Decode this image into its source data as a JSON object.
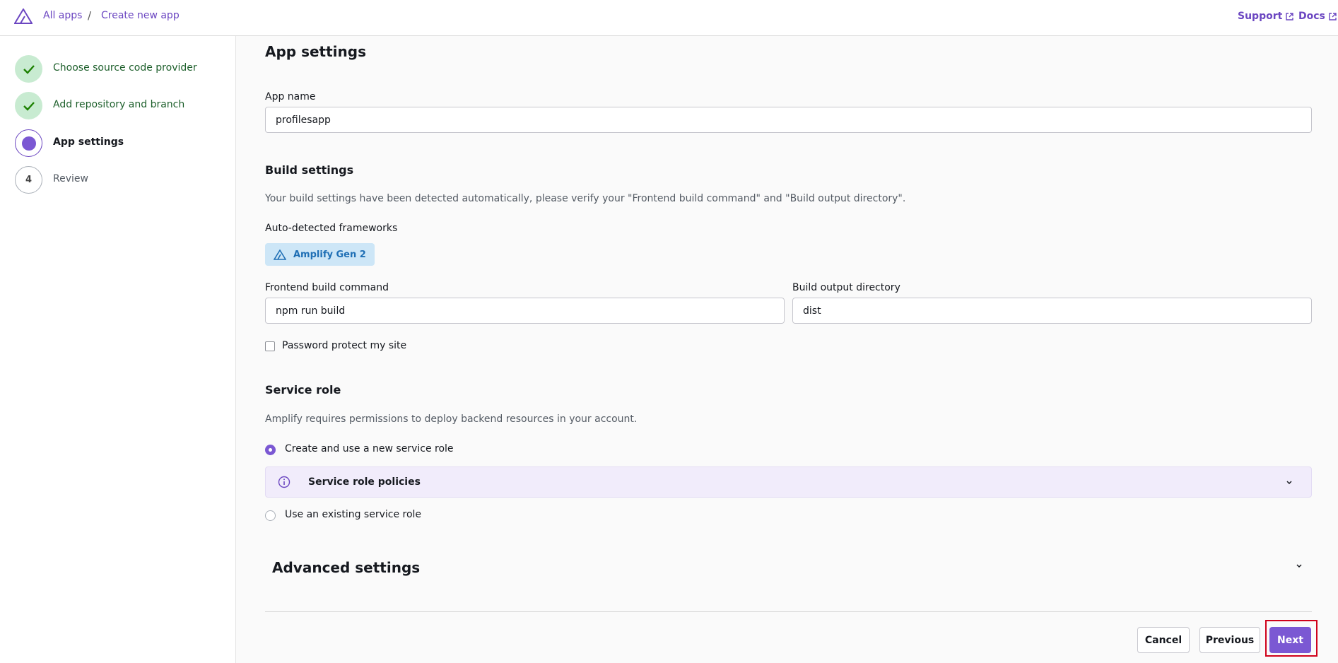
{
  "header": {
    "breadcrumb": [
      {
        "label": "All apps"
      },
      {
        "label": "Create new app"
      }
    ],
    "separator": "/",
    "links": [
      {
        "label": "Support"
      },
      {
        "label": "Docs"
      }
    ]
  },
  "steps": [
    {
      "label": "Choose source code provider",
      "state": "done"
    },
    {
      "label": "Add repository and branch",
      "state": "done"
    },
    {
      "label": "App settings",
      "state": "current"
    },
    {
      "label": "Review",
      "state": "todo",
      "number": "4"
    }
  ],
  "main": {
    "title": "App settings",
    "app_name": {
      "label": "App name",
      "value": "profilesapp"
    },
    "build": {
      "title": "Build settings",
      "description": "Your build settings have been detected automatically, please verify your \"Frontend build command\" and \"Build output directory\".",
      "frameworks_label": "Auto-detected frameworks",
      "framework": "Amplify Gen 2",
      "frontend_label": "Frontend build command",
      "frontend_value": "npm run build",
      "output_label": "Build output directory",
      "output_value": "dist",
      "password_label": "Password protect my site",
      "password_checked": false
    },
    "service_role": {
      "title": "Service role",
      "description": "Amplify requires permissions to deploy backend resources in your account.",
      "option_new": "Create and use a new service role",
      "policies_title": "Service role policies",
      "option_existing": "Use an existing service role",
      "selected": "new"
    },
    "advanced": {
      "title": "Advanced settings"
    }
  },
  "footer": {
    "cancel": "Cancel",
    "previous": "Previous",
    "next": "Next"
  },
  "colors": {
    "accent": "#7b58d3",
    "link": "#6b46c1",
    "done": "#c8ebd1",
    "badge": "#cde6f7",
    "highlight": "#d0021b"
  }
}
